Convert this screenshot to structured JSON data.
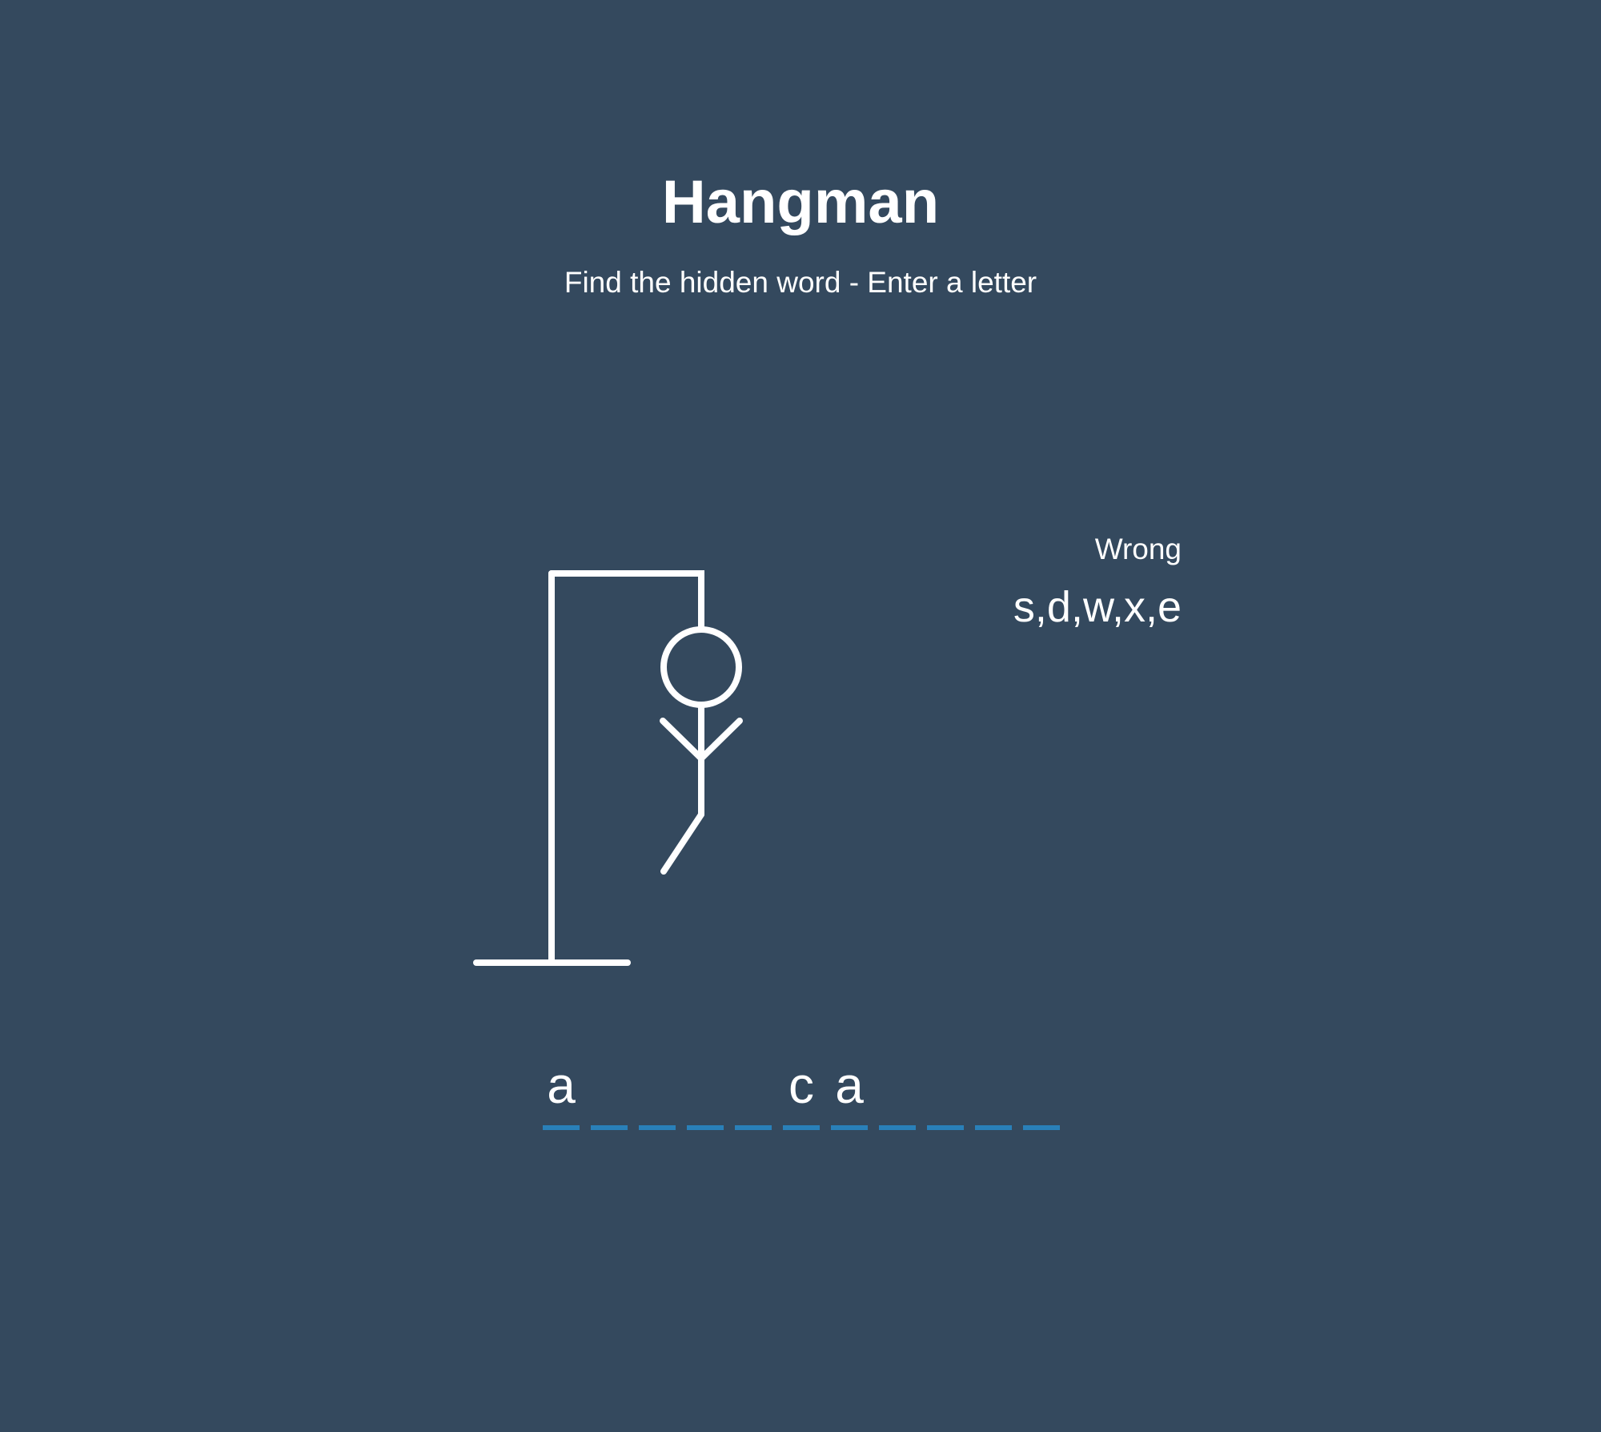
{
  "header": {
    "title": "Hangman",
    "subtitle": "Find the hidden word - Enter a letter"
  },
  "wrong": {
    "label": "Wrong",
    "letters": "s,d,w,x,e"
  },
  "word": {
    "letters": [
      "a",
      "",
      "",
      "",
      "",
      "c",
      "a",
      "",
      "",
      "",
      ""
    ]
  },
  "figure": {
    "parts_drawn": [
      "head",
      "body",
      "left-arm",
      "right-arm",
      "left-leg"
    ],
    "parts_total": 6
  },
  "colors": {
    "background": "#34495e",
    "text": "#ffffff",
    "underline": "#2980b9"
  }
}
